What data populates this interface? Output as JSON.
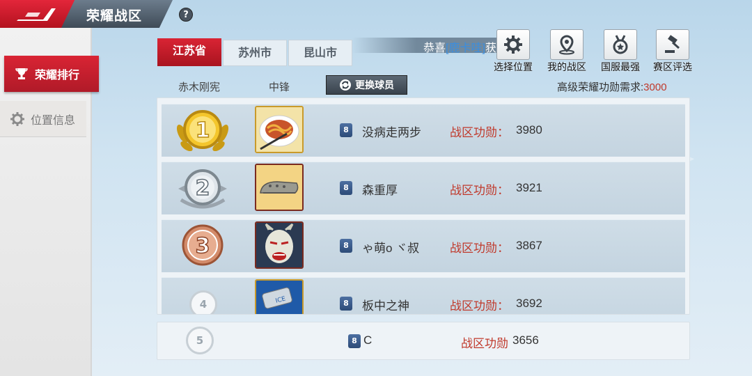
{
  "header": {
    "title": "荣耀战区",
    "help_label": "?"
  },
  "sidebar": {
    "items": [
      {
        "label": "荣耀排行",
        "active": true,
        "icon": "trophy-icon"
      },
      {
        "label": "位置信息",
        "active": false,
        "icon": "gear-icon"
      }
    ]
  },
  "tabs": [
    {
      "label": "江苏省",
      "active": true
    },
    {
      "label": "苏州市",
      "active": false
    },
    {
      "label": "昆山市",
      "active": false
    }
  ],
  "ticker": {
    "prefix": "恭喜",
    "highlight": "[鹿卡哇]",
    "suffix": "获"
  },
  "top_buttons": [
    {
      "label": "选择位置",
      "icon": "gear-icon"
    },
    {
      "label": "我的战区",
      "icon": "map-pin-icon"
    },
    {
      "label": "国服最强",
      "icon": "medal-icon"
    },
    {
      "label": "赛区评选",
      "icon": "gavel-icon"
    }
  ],
  "player": {
    "name": "赤木刚宪",
    "position": "中锋",
    "swap_label": "更换球员"
  },
  "requirement": {
    "label": "高级荣耀功勋需求:",
    "value": "3000"
  },
  "rankings": [
    {
      "rank": "1",
      "name": "没病走两步",
      "merit_label": "战区功勋：",
      "merit": "3980",
      "avatar": "noodles",
      "badge": "8"
    },
    {
      "rank": "2",
      "name": "森重厚",
      "merit_label": "战区功勋：",
      "merit": "3921",
      "avatar": "shoe",
      "badge": "8"
    },
    {
      "rank": "3",
      "name": "ゃ萌o ヾ叔",
      "merit_label": "战区功勋：",
      "merit": "3867",
      "avatar": "mask",
      "badge": "8"
    },
    {
      "rank": "4",
      "name": "板中之神",
      "merit_label": "战区功勋：",
      "merit": "3692",
      "avatar": "can",
      "badge": "8"
    }
  ],
  "self": {
    "rank": "5",
    "name": "C",
    "merit_label": "战区功勋",
    "merit": "3656",
    "badge": "8"
  },
  "colors": {
    "accent_red": "#d92434",
    "merit_red": "#c0392b",
    "highlight_blue": "#3a8ee0"
  }
}
